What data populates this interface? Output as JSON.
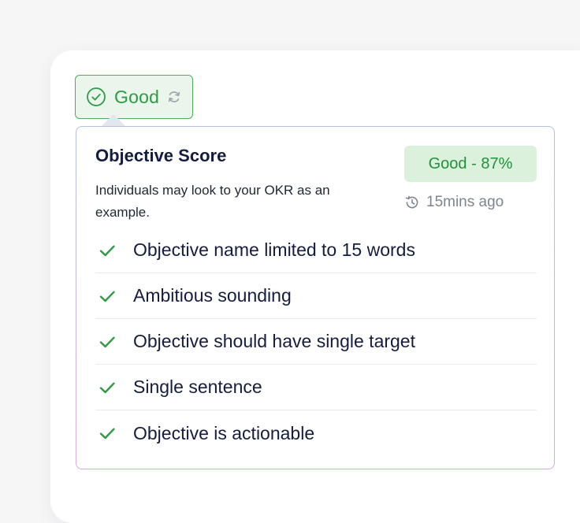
{
  "status_badge": {
    "label": "Good",
    "icon": "check-circle-icon",
    "action_icon": "refresh-icon",
    "color": "#2e9a44"
  },
  "score_card": {
    "title": "Objective Score",
    "description": "Individuals may look to your OKR as an example.",
    "score_label": "Good - 87%",
    "score_percent": 87,
    "updated": "15mins ago",
    "updated_icon": "history-icon",
    "checks": [
      {
        "label": "Objective name limited to 15 words",
        "passed": true
      },
      {
        "label": "Ambitious sounding",
        "passed": true
      },
      {
        "label": "Objective should have single target",
        "passed": true
      },
      {
        "label": "Single sentence",
        "passed": true
      },
      {
        "label": "Objective is actionable",
        "passed": true
      }
    ]
  },
  "colors": {
    "success": "#2e9a44",
    "success_bg": "#dcf1dc",
    "text_primary": "#141d40",
    "text_muted": "#7c8690"
  }
}
